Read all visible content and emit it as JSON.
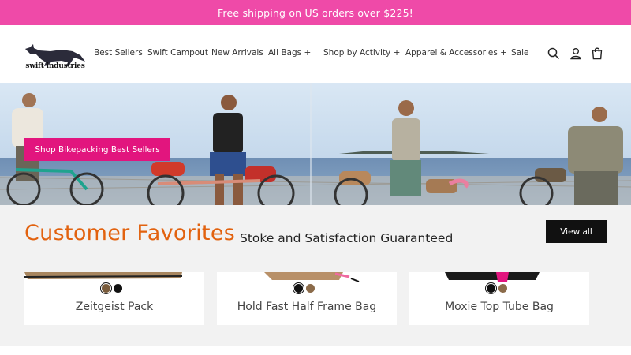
{
  "announcement": "Free shipping on US orders over $225!",
  "brand": {
    "logo_text": "swift industries"
  },
  "nav": [
    {
      "label": "Best Sellers"
    },
    {
      "label": "Swift Campout"
    },
    {
      "label": "New Arrivals"
    },
    {
      "label": "All Bags +"
    },
    {
      "label": "Shop by Activity +"
    },
    {
      "label": "Apparel & Accessories +"
    },
    {
      "label": "Sale"
    }
  ],
  "header_icons": [
    "search-icon",
    "account-icon",
    "cart-icon"
  ],
  "hero": {
    "button_label": "Shop Bikepacking Best Sellers"
  },
  "favorites": {
    "title": "Customer Favorites",
    "subtitle": "Stoke and Satisfaction Guaranteed",
    "view_all_label": "View all",
    "products": [
      {
        "name": "Zeitgeist Pack",
        "swatches": [
          "#7a5c3c",
          "#111111"
        ],
        "selected": 0
      },
      {
        "name": "Hold Fast Half Frame Bag",
        "swatches": [
          "#111111",
          "#8b6b4a"
        ],
        "selected": 0
      },
      {
        "name": "Moxie Top Tube Bag",
        "swatches": [
          "#111111",
          "#8b6b4a"
        ],
        "selected": 0
      }
    ]
  },
  "colors": {
    "announcement_bg": "#ef4aa8",
    "hero_button": "#e2157e",
    "title_accent": "#e2620f"
  }
}
